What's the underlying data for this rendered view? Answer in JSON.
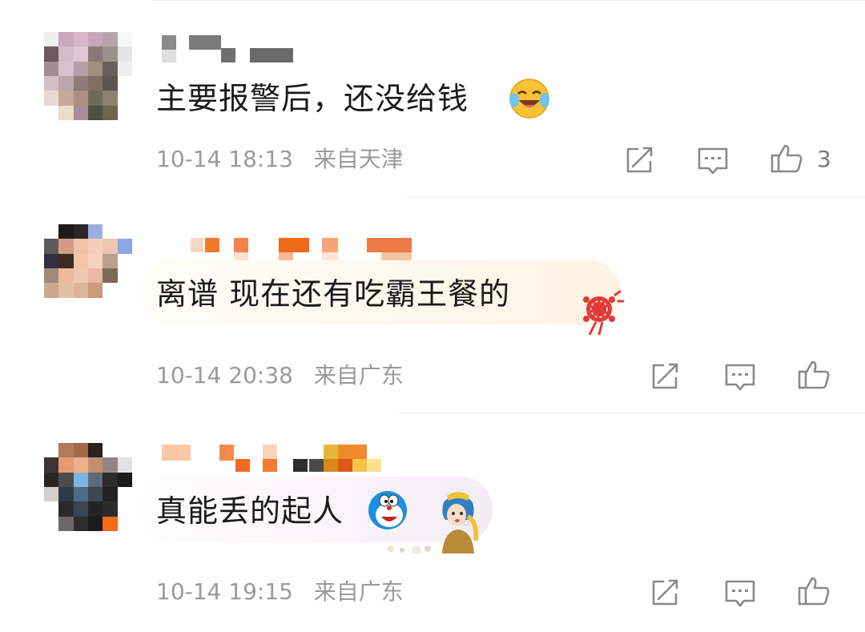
{
  "comments": [
    {
      "text": "主要报警后，还没给钱",
      "time": "10-14 18:13",
      "location": "来自天津",
      "like_count": "3",
      "emoji": "laughing-crying-emoji"
    },
    {
      "text": "离谱 现在还有吃霸王餐的",
      "time": "10-14 20:38",
      "location": "来自广东",
      "like_count": "",
      "emoji": "red-lucky-knot-sticker"
    },
    {
      "text": "真能丢的起人",
      "time": "10-14 19:15",
      "location": "来自广东",
      "like_count": "",
      "emoji": "doraemon-and-pearl-earring-girl-sticker"
    }
  ],
  "icons": {
    "share": "share-icon",
    "reply": "comment-icon",
    "like": "thumbs-up-icon"
  },
  "colors": {
    "text": "#1a1a1a",
    "meta": "#9a9a9a",
    "icon": "#8a8a8a",
    "divider": "#ececec"
  }
}
